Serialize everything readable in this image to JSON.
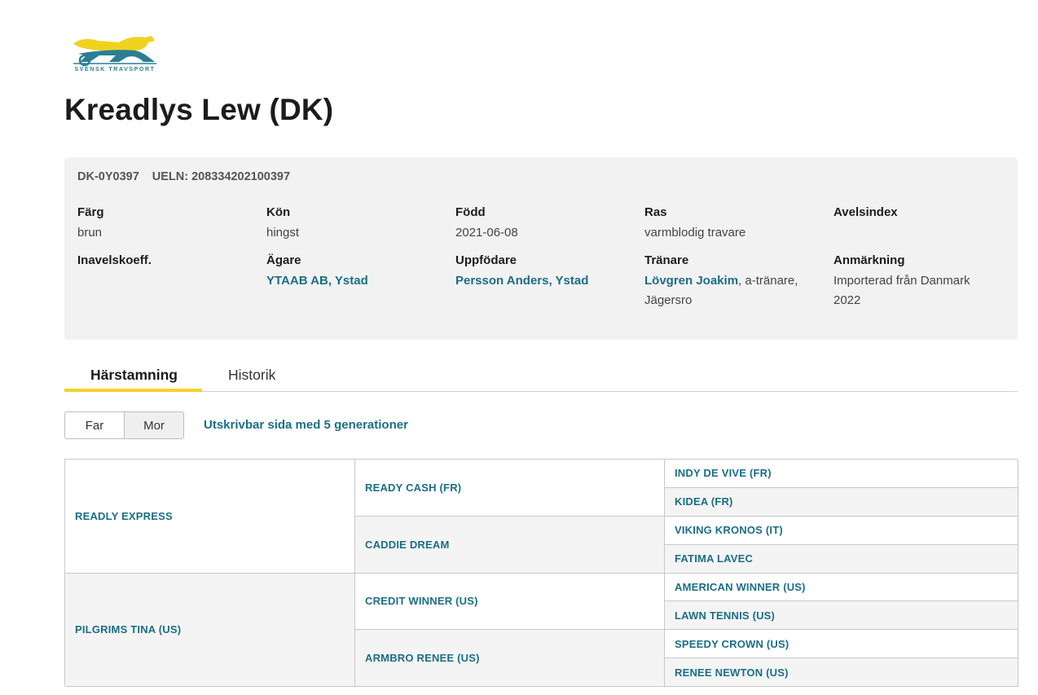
{
  "brand": {
    "logo_text": "SVENSK TRAVSPORT"
  },
  "horse": {
    "name": "Kreadlys Lew (DK)",
    "reg_no": "DK-0Y0397",
    "ueln": "UELN: 208334202100397"
  },
  "details": {
    "farg": {
      "label": "Färg",
      "value": "brun"
    },
    "kon": {
      "label": "Kön",
      "value": "hingst"
    },
    "fodd": {
      "label": "Född",
      "value": "2021-06-08"
    },
    "ras": {
      "label": "Ras",
      "value": "varmblodig travare"
    },
    "avelsindex": {
      "label": "Avelsindex",
      "value": ""
    },
    "inavelskoeff": {
      "label": "Inavelskoeff.",
      "value": ""
    },
    "agare": {
      "label": "Ägare",
      "value": "YTAAB AB, Ystad"
    },
    "uppfodare": {
      "label": "Uppfödare",
      "value": "Persson Anders, Ystad"
    },
    "tranare": {
      "label": "Tränare",
      "link": "Lövgren Joakim",
      "suffix": ", a-tränare, Jägersro"
    },
    "anmarkning": {
      "label": "Anmärkning",
      "value": "Importerad från Danmark 2022"
    }
  },
  "tabs": {
    "harstamning": "Härstamning",
    "historik": "Historik"
  },
  "toggle": {
    "far": "Far",
    "mor": "Mor"
  },
  "print_link": "Utskrivbar sida med 5 generationer",
  "pedigree": {
    "gen1": [
      "READLY EXPRESS",
      "PILGRIMS TINA (US)"
    ],
    "gen2": [
      "READY CASH (FR)",
      "CADDIE DREAM",
      "CREDIT WINNER (US)",
      "ARMBRO RENEE (US)"
    ],
    "gen3": [
      "INDY DE VIVE (FR)",
      "KIDEA (FR)",
      "VIKING KRONOS (IT)",
      "FATIMA LAVEC",
      "AMERICAN WINNER (US)",
      "LAWN TENNIS (US)",
      "SPEEDY CROWN (US)",
      "RENEE NEWTON (US)"
    ]
  }
}
